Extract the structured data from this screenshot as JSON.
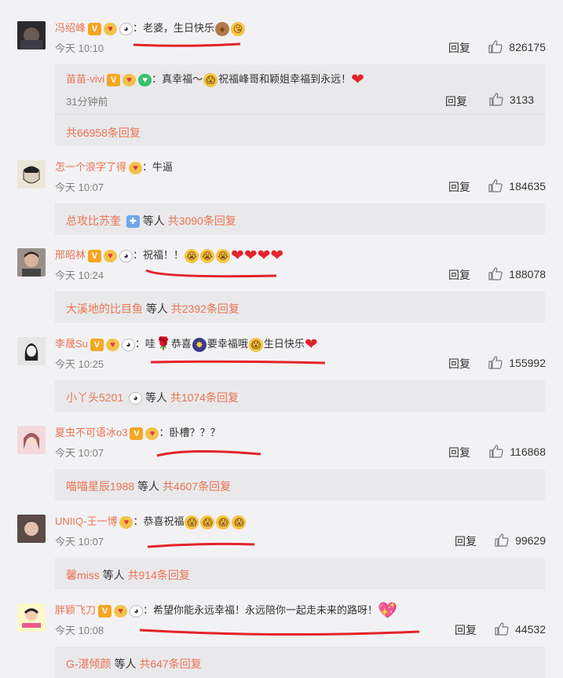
{
  "reply_label": "回复",
  "comments": [
    {
      "user": "冯绍峰",
      "text": "老婆，生日快乐",
      "time": "今天 10:10",
      "likes": "826175",
      "sub_reply": {
        "user": "苗苗-vivi",
        "text_a": "真幸福～",
        "text_b": "祝福峰哥和颖姐幸福到永远！",
        "time": "31分钟前",
        "likes": "3133"
      },
      "total": "共66958条回复"
    },
    {
      "user": "怎一个浪字了得",
      "text": "牛逼",
      "time": "今天 10:07",
      "likes": "184635",
      "from": "总攻比苏奎",
      "etc": "等人",
      "total": "共3090条回复"
    },
    {
      "user": "邢昭林",
      "text": "祝福！！",
      "time": "今天 10:24",
      "likes": "188078",
      "from": "大溪地的比目鱼",
      "etc": "等人",
      "total": "共2392条回复"
    },
    {
      "user": "李晟Su",
      "text_a": "哇",
      "text_b": "恭喜",
      "text_c": "要幸福哦",
      "text_d": "生日快乐",
      "time": "今天 10:25",
      "likes": "155992",
      "from": "小丫头5201",
      "etc": "等人",
      "total": "共1074条回复"
    },
    {
      "user": "夏虫不可语冰o3",
      "text": "卧槽？？？",
      "time": "今天 10:07",
      "likes": "116868",
      "from": "喵喵星辰1988",
      "etc": "等人",
      "total": "共4607条回复"
    },
    {
      "user": "UNIIQ-王一博",
      "text": "恭喜祝福",
      "time": "今天 10:07",
      "likes": "99629",
      "from": "馨miss",
      "etc": "等人",
      "total": "共914条回复"
    },
    {
      "user": "胖颖飞刀",
      "text": "希望你能永远幸福！永远陪你一起走未来的路呀！",
      "time": "今天 10:08",
      "likes": "44532",
      "from": "G-湛倾颜",
      "etc": "等人",
      "total": "共647条回复"
    }
  ],
  "colors": {
    "link": "#eb7350",
    "underline": "#e3242b",
    "reply_bg": "#e9e9ec"
  },
  "icons": [
    "vip-badge-icon",
    "heart-badge-icon",
    "panda-icon",
    "thumbs-up-icon",
    "red-heart-icon"
  ]
}
